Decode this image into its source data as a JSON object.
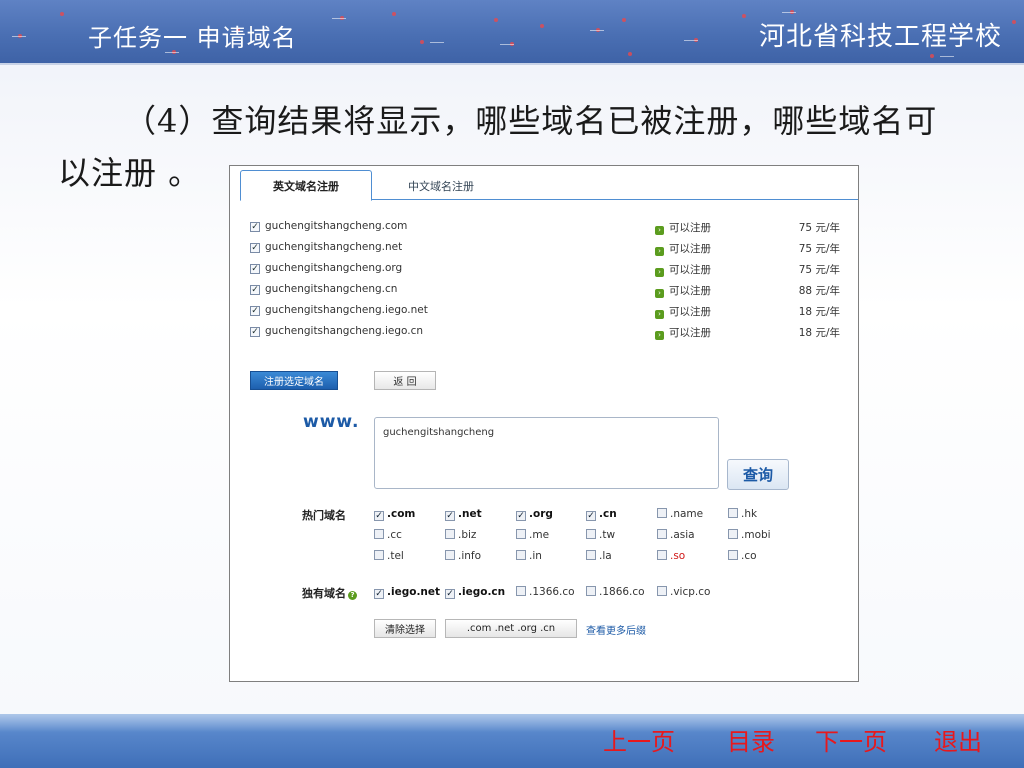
{
  "header": {
    "left_title": "子任务一  申请域名",
    "right_title": "河北省科技工程学校"
  },
  "slide": {
    "line1": "（4）查询结果将显示，哪些域名已被注册，哪些域名可",
    "line2": "以注册 。"
  },
  "panel": {
    "tabs": [
      {
        "label": "英文域名注册",
        "active": true
      },
      {
        "label": "中文域名注册",
        "active": false
      }
    ],
    "results": [
      {
        "domain": "guchengitshangcheng.com",
        "status": "可以注册",
        "price": "75 元/年",
        "checked": true
      },
      {
        "domain": "guchengitshangcheng.net",
        "status": "可以注册",
        "price": "75 元/年",
        "checked": true
      },
      {
        "domain": "guchengitshangcheng.org",
        "status": "可以注册",
        "price": "75 元/年",
        "checked": true
      },
      {
        "domain": "guchengitshangcheng.cn",
        "status": "可以注册",
        "price": "88 元/年",
        "checked": true
      },
      {
        "domain": "guchengitshangcheng.iego.net",
        "status": "可以注册",
        "price": "18 元/年",
        "checked": true
      },
      {
        "domain": "guchengitshangcheng.iego.cn",
        "status": "可以注册",
        "price": "18 元/年",
        "checked": true
      }
    ],
    "register_button": "注册选定域名",
    "back_button": "返 回",
    "www_label": "www.",
    "search_value": "guchengitshangcheng",
    "query_button": "查询",
    "hot_label": "热门域名",
    "hot_rows": [
      [
        {
          "label": ".com",
          "checked": true
        },
        {
          "label": ".net",
          "checked": true
        },
        {
          "label": ".org",
          "checked": true
        },
        {
          "label": ".cn",
          "checked": true
        },
        {
          "label": ".name",
          "checked": false
        },
        {
          "label": ".hk",
          "checked": false
        }
      ],
      [
        {
          "label": ".cc",
          "checked": false
        },
        {
          "label": ".biz",
          "checked": false
        },
        {
          "label": ".me",
          "checked": false
        },
        {
          "label": ".tw",
          "checked": false
        },
        {
          "label": ".asia",
          "checked": false
        },
        {
          "label": ".mobi",
          "checked": false
        }
      ],
      [
        {
          "label": ".tel",
          "checked": false
        },
        {
          "label": ".info",
          "checked": false
        },
        {
          "label": ".in",
          "checked": false
        },
        {
          "label": ".la",
          "checked": false
        },
        {
          "label": ".so",
          "checked": false,
          "highlight": "#d01818"
        },
        {
          "label": ".co",
          "checked": false
        }
      ]
    ],
    "unique_label": "独有域名",
    "unique_items": [
      {
        "label": ".iego.net",
        "checked": true
      },
      {
        "label": ".iego.cn",
        "checked": true
      },
      {
        "label": ".1366.co",
        "checked": false
      },
      {
        "label": ".1866.co",
        "checked": false
      },
      {
        "label": ".vicp.co",
        "checked": false
      }
    ],
    "clear_button": "清除选择",
    "common_button": ".com .net .org .cn",
    "more_link": "查看更多后缀"
  },
  "nav": {
    "prev": "上一页",
    "toc": "目录",
    "next": "下一页",
    "exit": "退出"
  },
  "colors": {
    "banner_blue": "#4a6fb3",
    "nav_red": "#e8181c",
    "link_blue": "#1c5aa6",
    "ok_green": "#5b9c1e"
  }
}
